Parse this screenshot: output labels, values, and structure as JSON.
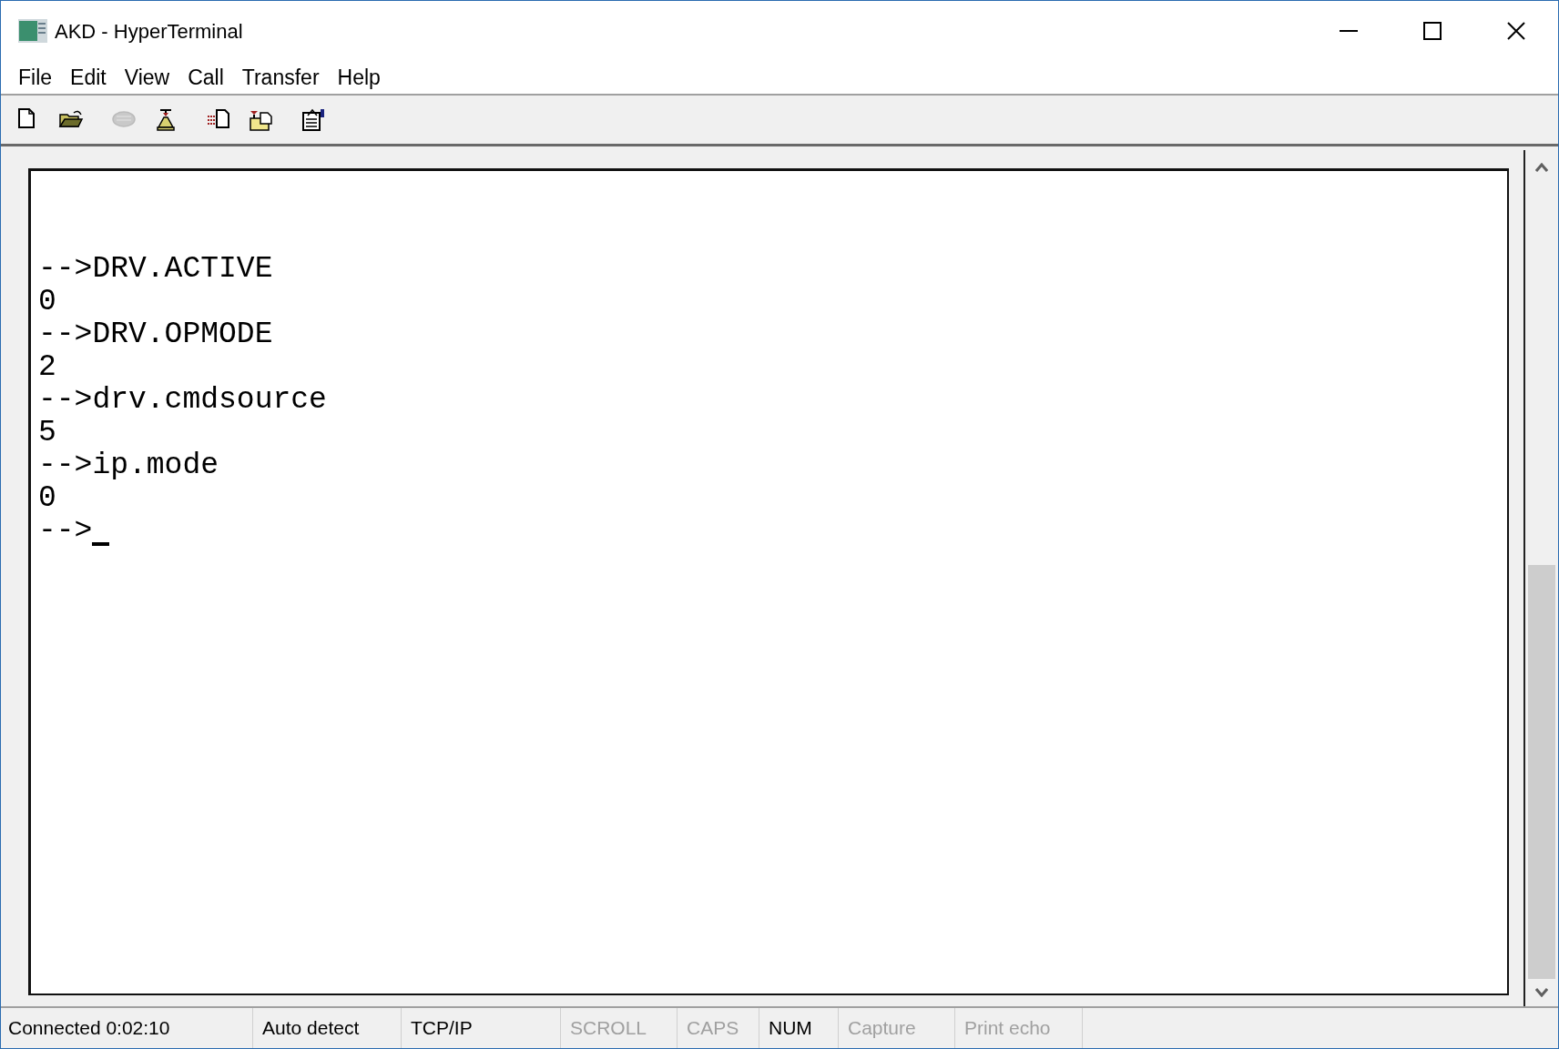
{
  "window": {
    "title": "AKD - HyperTerminal"
  },
  "menu": [
    "File",
    "Edit",
    "View",
    "Call",
    "Transfer",
    "Help"
  ],
  "toolbar": [
    {
      "kind": "new",
      "disabled": false
    },
    {
      "kind": "open",
      "disabled": false
    },
    {
      "kind": "disconnect",
      "disabled": true
    },
    {
      "kind": "dial",
      "disabled": false
    },
    {
      "kind": "send",
      "disabled": false
    },
    {
      "kind": "receive",
      "disabled": false
    },
    {
      "kind": "properties",
      "disabled": false
    }
  ],
  "terminal": {
    "lines": [
      "-->DRV.ACTIVE",
      "0",
      "-->DRV.OPMODE",
      "2",
      "-->drv.cmdsource",
      "5",
      "-->ip.mode",
      "0",
      "-->"
    ],
    "cursor": true
  },
  "status_bar": [
    {
      "text": "Connected 0:02:10",
      "enabled": true
    },
    {
      "text": "Auto detect",
      "enabled": true
    },
    {
      "text": "TCP/IP",
      "enabled": true
    },
    {
      "text": "SCROLL",
      "enabled": false
    },
    {
      "text": "CAPS",
      "enabled": false
    },
    {
      "text": "NUM",
      "enabled": true
    },
    {
      "text": "Capture",
      "enabled": false
    },
    {
      "text": "Print echo",
      "enabled": false
    }
  ]
}
